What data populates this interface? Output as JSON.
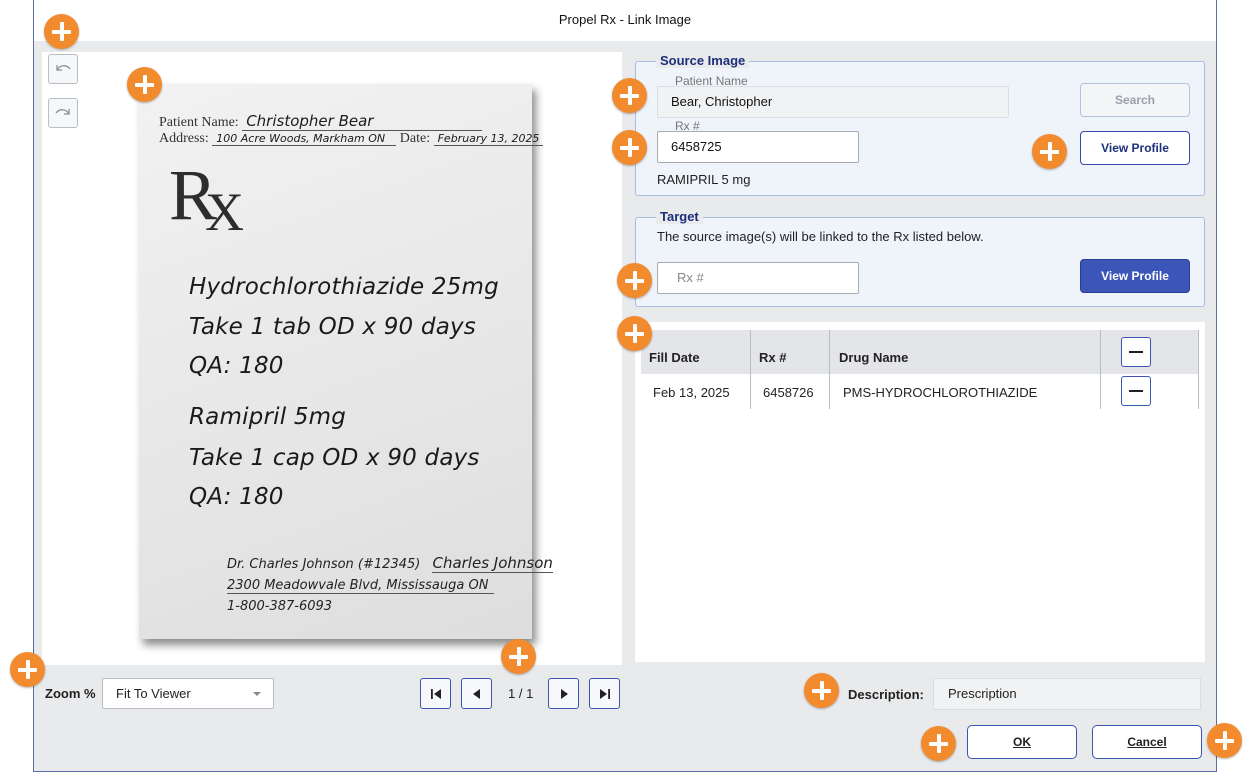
{
  "window": {
    "title": "Propel Rx - Link Image"
  },
  "viewer": {
    "toolbar": {
      "undo_icon": "rotate-left-icon",
      "redo_icon": "rotate-right-icon"
    },
    "prescription": {
      "patient_label": "Patient Name:",
      "patient_value": "Christopher Bear",
      "address_label": "Address:",
      "address_value": "100 Acre Woods, Markham ON",
      "date_label": "Date:",
      "date_value": "February 13, 2025",
      "rx_symbol_r": "R",
      "rx_symbol_x": "X",
      "lines": [
        "Hydrochlorothiazide 25mg",
        "Take 1 tab OD x 90 days",
        "QA: 180",
        "Ramipril 5mg",
        "Take 1 cap OD x 90 days",
        "QA: 180"
      ],
      "doctor": "Dr. Charles Johnson (#12345)",
      "signature": "Charles Johnson",
      "doctor_address": "2300 Meadowvale Blvd, Mississauga ON",
      "doctor_phone": "1-800-387-6093"
    },
    "zoom": {
      "label": "Zoom %",
      "value": "Fit To Viewer"
    },
    "pager": {
      "indicator": "1 / 1"
    }
  },
  "source_image": {
    "title": "Source Image",
    "patient_name_label": "Patient Name",
    "patient_name_value": "Bear, Christopher",
    "rx_label": "Rx #",
    "rx_value": "6458725",
    "drug": "RAMIPRIL 5 mg",
    "search_button": "Search",
    "view_profile_button": "View Profile"
  },
  "target": {
    "title": "Target",
    "description": "The source image(s) will be linked to the Rx listed below.",
    "rx_placeholder": "Rx #",
    "view_profile_button": "View Profile"
  },
  "table": {
    "headers": {
      "fill_date": "Fill Date",
      "rx": "Rx #",
      "drug_name": "Drug Name"
    },
    "rows": [
      {
        "fill_date": "Feb 13, 2025",
        "rx": "6458726",
        "drug_name": "PMS-HYDROCHLOROTHIAZIDE"
      }
    ]
  },
  "footer": {
    "description_label": "Description:",
    "description_value": "Prescription",
    "ok_button": "OK",
    "cancel_button": "Cancel"
  },
  "colors": {
    "accent": "#3b55b8",
    "hotspot": "#f28a2e",
    "group_border": "#a9bde0"
  }
}
